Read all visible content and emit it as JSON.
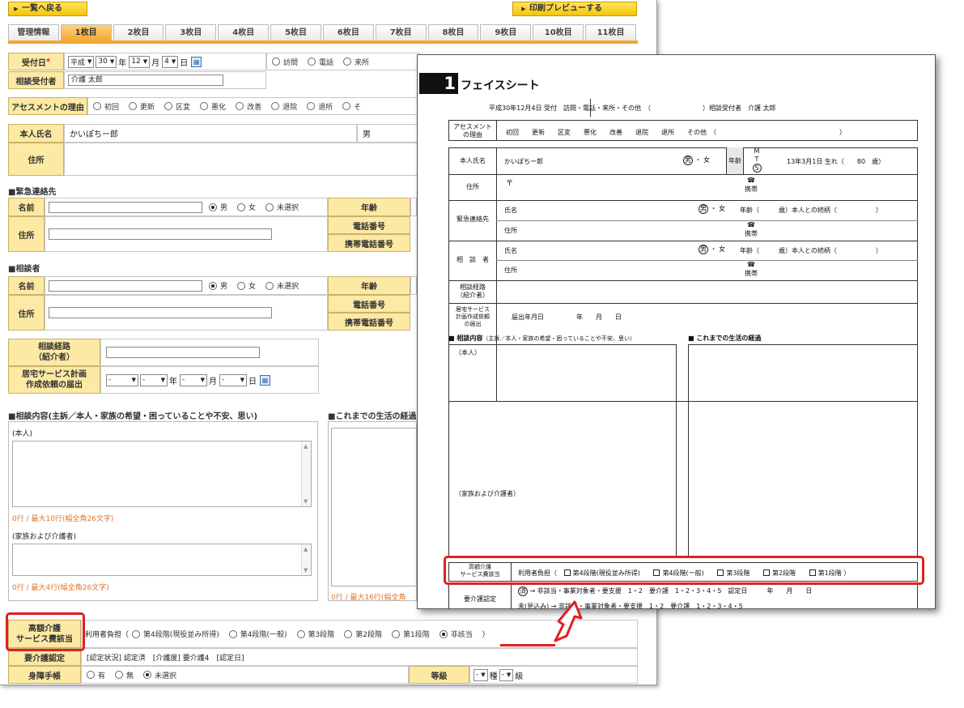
{
  "toolbar": {
    "back_label": "一覧へ戻る",
    "print_label": "印刷プレビューする"
  },
  "tabs": [
    "管理情報",
    "1枚目",
    "2枚目",
    "3枚目",
    "4枚目",
    "5枚目",
    "6枚目",
    "7枚目",
    "8枚目",
    "9枚目",
    "10枚目",
    "11枚目"
  ],
  "form": {
    "reception": {
      "label": "受付日",
      "required_mark": "*",
      "era": "平成",
      "year": "30",
      "year_unit": "年",
      "month": "12",
      "month_unit": "月",
      "day": "4",
      "day_unit": "日",
      "methods": [
        "訪問",
        "電話",
        "来所"
      ]
    },
    "receiver": {
      "label": "相談受付者",
      "value": "介護 太郎"
    },
    "assessment": {
      "label": "アセスメントの理由",
      "options": [
        "初回",
        "更新",
        "区変",
        "悪化",
        "改善",
        "退院",
        "退所"
      ],
      "more": "そ"
    },
    "person": {
      "name_label": "本人氏名",
      "name_value": "かいぽちー郎",
      "gender": "男",
      "address_label": "住所"
    },
    "emergency": {
      "title": "■緊急連絡先",
      "name_label": "名前",
      "gender_options": [
        "男",
        "女",
        "未選択"
      ],
      "selected": "男",
      "age_label": "年齢",
      "address_label": "住所",
      "phone_label": "電話番号",
      "mobile_label": "携帯電話番号"
    },
    "consultant": {
      "title": "■相談者",
      "name_label": "名前",
      "gender_options": [
        "男",
        "女",
        "未選択"
      ],
      "selected": "男",
      "age_label": "年齢",
      "address_label": "住所",
      "phone_label": "電話番号",
      "mobile_label": "携帯電話番号"
    },
    "route": {
      "label_line1": "相談経路",
      "label_line2": "（紹介者）"
    },
    "plan": {
      "label_line1": "居宅サービス計画",
      "label_line2": "作成依頼の届出",
      "year_unit": "年",
      "month_unit": "月",
      "day_unit": "日",
      "empty": "-"
    },
    "consult_content": {
      "title": "■相談内容(主訴／本人・家族の希望・困っていることや不安、思い)",
      "self_label": "(本人)",
      "self_hint": "0行 / 最大10行(幅全角26文字)",
      "family_label": "(家族および介護者)",
      "family_hint": "0行 / 最大4行(幅全角26文字)"
    },
    "history": {
      "title": "■これまでの生活の経過",
      "hint": "0行 / 最大16行(幅全角"
    },
    "high_cost": {
      "label_line1": "高額介護",
      "label_line2": "サービス費該当",
      "prefix": "利用者負担（",
      "options": [
        "第4段階(現役並み所得)",
        "第4段階(一般)",
        "第3段階",
        "第2段階",
        "第1段階",
        "非該当"
      ],
      "selected": "非該当",
      "suffix": "）"
    },
    "care_cert": {
      "label": "要介護認定",
      "value": "[認定状況] 認定済　[介護度] 要介護4　[認定日]"
    },
    "disability": {
      "label": "身障手帳",
      "options": [
        "有",
        "無",
        "未選択"
      ],
      "selected": "未選択",
      "grade_label": "等級",
      "kind_unit": "種",
      "grade_unit": "級",
      "empty": "-"
    }
  },
  "preview": {
    "number": "1",
    "title": "フェイスシート",
    "reception_line": "平成30年12月4日 受付　訪問・電話・来所・その他　（　　　　　　　　）相談受付者　介護 太郎",
    "assessment": {
      "label_line1": "アセスメント",
      "label_line2": "の理由",
      "options": "初回　　更新　　区変　　悪化　　改善　　退院　　退所　　その他　（　　　　　　　　　　　　　　　　　　　）"
    },
    "person": {
      "label": "本人氏名",
      "name": "かいぽちー郎",
      "gender_male": "男",
      "gender_sep": "・",
      "gender_female": "女",
      "age_label": "年齢",
      "eras": [
        "M",
        "T",
        "S"
      ],
      "birth": "13年3月1日 生れ（　　80　歳）"
    },
    "address": {
      "label": "住所",
      "postal": "〒",
      "phone_icon": "☎",
      "mobile": "携帯"
    },
    "emergency": {
      "label": "緊急連絡先",
      "name": "氏名",
      "gender_male": "男",
      "gender_sep": "・",
      "gender_female": "女",
      "age_rel": "年齢（　　　歳）本人との続柄（　　　　　　）",
      "address": "住所",
      "phone_icon": "☎",
      "mobile": "携帯"
    },
    "consultant": {
      "label": "相　談　者",
      "name": "氏名",
      "gender_male": "男",
      "gender_sep": "・",
      "gender_female": "女",
      "age_rel": "年齢（　　　歳）本人との続柄（　　　　　　）",
      "address": "住所",
      "phone_icon": "☎",
      "mobile": "携帯"
    },
    "route": {
      "label_line1": "相談経路",
      "label_line2": "（紹介者）"
    },
    "plan": {
      "label_line1": "居宅サービス",
      "label_line2": "計画作成依頼",
      "label_line3": "の届出",
      "value": "届出年月日　　　　　年　　月　　日"
    },
    "consult": {
      "title": "■ 相談内容",
      "sub": "（主訴／本人・家族の希望・困っていることや不安、思い）",
      "self": "（本人）",
      "family": "（家族および介護者）"
    },
    "history": {
      "title": "■ これまでの生活の経過"
    },
    "high_cost": {
      "label_line1": "高額介護",
      "label_line2": "サービス費該当",
      "prefix": "利用者負担（",
      "options": [
        "第4段階(現役並み所得)",
        "第4段階(一般)",
        "第3段階",
        "第2段階",
        "第1段階"
      ],
      "suffix": "）"
    },
    "care": {
      "label": "要介護認定",
      "mark_done": "済",
      "line1": "→ 非該当・事業対象者・要支援　1・2　要介護　1・2・3・4・5　認定日　　　年　　月　　日",
      "mark_not": "未(見込み)",
      "line2": "→ 非該当・事業対象者・要支援　1・2　要介護　1・2・3・4・5"
    }
  }
}
